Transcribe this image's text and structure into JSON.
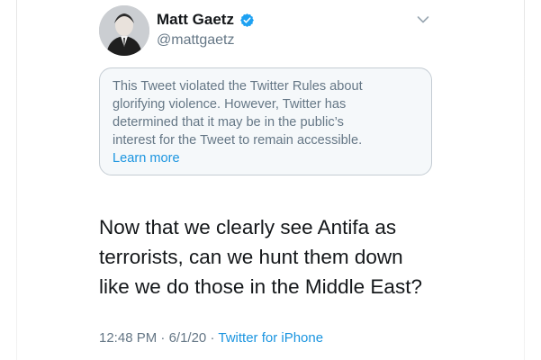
{
  "tweet": {
    "author_name": "Matt Gaetz",
    "handle": "@mattgaetz",
    "verified": true,
    "notice": {
      "line1": "This Tweet violated the Twitter Rules about",
      "line2": "glorifying violence. However, Twitter has",
      "line3": "determined that it may be in the public’s",
      "line4": "interest for the Tweet to remain accessible.",
      "learn_more": "Learn more"
    },
    "text": {
      "line1": "Now that we clearly see Antifa as",
      "line2": "terrorists, can we hunt them down",
      "line3": "like we do those in the Middle East?"
    },
    "time": "12:48 PM",
    "date": "6/1/20",
    "separator": "·",
    "source": "Twitter for iPhone"
  },
  "icons": {
    "verified": "verified-badge-icon",
    "menu": "chevron-down-icon"
  },
  "colors": {
    "name": "#14171a",
    "secondary": "#657786",
    "link": "#1b95e0",
    "notice_bg": "#f5f8fa",
    "notice_border": "#c4ccd3"
  }
}
